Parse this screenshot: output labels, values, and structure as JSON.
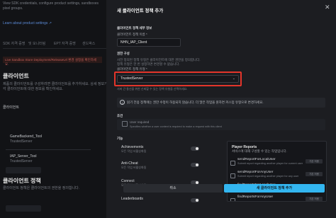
{
  "background": {
    "desc_line1": "View SDK credentials, configure product settings, sandboxes",
    "desc_line2": "pixel groups.",
    "learn_more": "Learn about product settings ↗",
    "tabs": [
      "SDK 자격 증명",
      "및 모니터링",
      "EPT 자격 증명",
      "샌드박스"
    ],
    "warning": "Live Sandbox Store Deployment/ReleaseUrl 환경 설정을 확인하세요.",
    "clients_heading": "클라이언트",
    "clients_desc1": "제품의 클라이언트를 구성하려면 클라이언트를 추가하세요. 상세 정보가 포함된",
    "clients_desc2": "각 클라이언트에 대한 정보를 확인하세요.",
    "client_label": "클라이언트",
    "client_items": [
      {
        "name": "GameBackend_Tool",
        "sub": "TrustedServer"
      },
      {
        "name": "IAP_Server_Tool",
        "sub": "TrustedServer"
      }
    ],
    "policies_heading": "클라이언트 정책",
    "policies_desc": "클라이언트 정책은 클라이언트의 권한을 정의합니다."
  },
  "panel": {
    "title": "새 클라이언트 정책 추가",
    "close_icon": "close-icon",
    "section_basic": "클라이언트 정책 세부 정보",
    "name_label": "클라이언트 정책 이름 *",
    "name_value": "NHN_IAP_Client",
    "section_perm": "권한 구성",
    "perm_desc1": "사전 정의된 정책 유형은 클라이언트에 대한 권한을 정의합니다.",
    "perm_desc2": "정책 유형은 한 번 설정하면 변경할 수 없습니다.",
    "policy_type_label": "클라이언트 정책 유형 *",
    "policy_type_value": "TrustedServer",
    "policy_type_hint": "서버 간 통신을 위한 신뢰할 수 있는 정책 유형을 선택하세요.",
    "info_text": "읽기 전용 정책에는 권한 수정이 허용되지 않습니다. 더 많은 작업을 원하면 커스텀 유형으로 변경하세요.",
    "conditions_label": "조건",
    "condition_item": "User required",
    "condition_desc": "Specifies whether a user context is required to make a request with this client",
    "features_label": "기능",
    "features": [
      {
        "name": "Achievements",
        "desc": "모든 작업 비활성화됨"
      },
      {
        "name": "Anti-Cheat",
        "desc": "모든 작업 비활성화됨"
      },
      {
        "name": "Connect",
        "desc": "모든 작업 비활성화됨"
      },
      {
        "name": "Leaderboards",
        "desc": ""
      }
    ],
    "right_title": "Player Reports",
    "right_subtitle": "서비스에 대해 구성할 수 있는 작업입니다.",
    "actions": [
      {
        "name": "sendReportForLocalUser",
        "desc": "Submit report regarding another player for current user",
        "badge": "기본 허용"
      },
      {
        "name": "sendReportForAnyUser",
        "desc": "Submit report regarding another player for any user",
        "badge": "기본 허용"
      },
      {
        "name": "findReportsForLocalUser",
        "desc": "Get reports reported by current user",
        "badge": "기본 허용"
      },
      {
        "name": "findReportsForAnyUser",
        "desc": "",
        "badge": "기본 허용"
      }
    ],
    "cancel": "취소",
    "create": "새 클라이언트 정책 추가"
  }
}
